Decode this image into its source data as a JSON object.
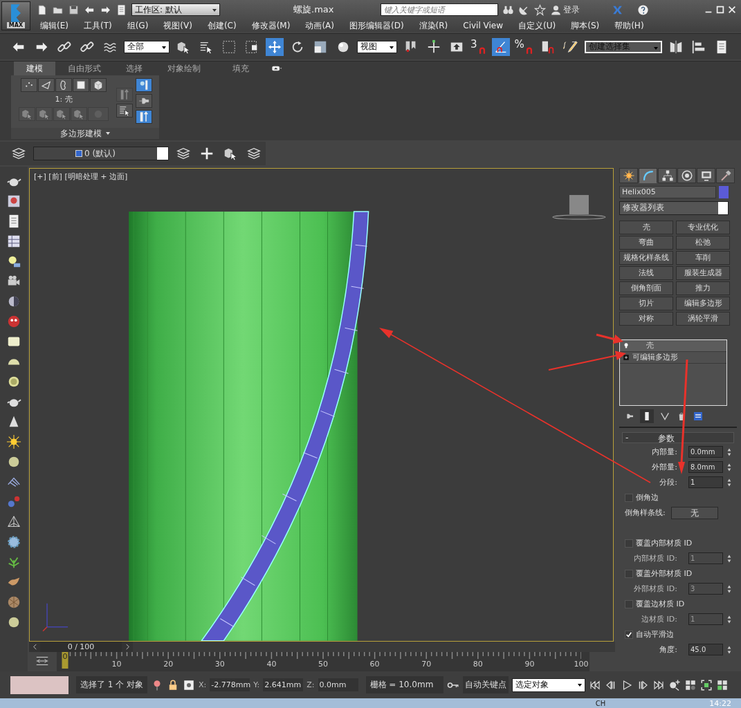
{
  "title_bar": {
    "app_menu_label": "MAX",
    "workspace": "工作区: 默认",
    "file_title": "螺旋.max",
    "search": {
      "placeholder": "键入关键字或短语"
    },
    "sign_in": "登录"
  },
  "menu_bar": [
    "编辑(E)",
    "工具(T)",
    "组(G)",
    "视图(V)",
    "创建(C)",
    "修改器(M)",
    "动画(A)",
    "图形编辑器(D)",
    "渲染(R)",
    "Civil View",
    "自定义(U)",
    "脚本(S)",
    "帮助(H)"
  ],
  "main_toolbar": {
    "selection_filter": "全部",
    "reference_coord": "视图",
    "move_active": true,
    "angle_snap_active": true,
    "snap_label": "3",
    "percent_label": "%",
    "selection_set": "创建选择集"
  },
  "ribbon": {
    "tabs": [
      {
        "label": "建模",
        "selected": true
      },
      {
        "label": "自由形式",
        "selected": false
      },
      {
        "label": "选择",
        "selected": false
      },
      {
        "label": "对象绘制",
        "selected": false
      },
      {
        "label": "填充",
        "selected": false
      }
    ],
    "panel_label": "1: 壳",
    "panel_title": "多边形建模"
  },
  "layer_toolbar": {
    "layer": "0 (默认)"
  },
  "viewport": {
    "label": "[+] [前] [明暗处理 + 边面]"
  },
  "command_panel": {
    "tabs": [
      {
        "kind": "create",
        "selected": false
      },
      {
        "kind": "modify",
        "selected": true
      },
      {
        "kind": "hierarchy",
        "selected": false
      },
      {
        "kind": "motion",
        "selected": false
      },
      {
        "kind": "display",
        "selected": false
      },
      {
        "kind": "utilities",
        "selected": false
      }
    ],
    "object_name": "Helix005",
    "modifier_list": "修改器列表",
    "modifier_buttons": [
      "壳",
      "专业优化",
      "弯曲",
      "松弛",
      "规格化样条线",
      "车削",
      "法线",
      "服装生成器",
      "倒角剖面",
      "推力",
      "切片",
      "编辑多边形",
      "对称",
      "涡轮平滑"
    ],
    "stack": [
      {
        "kind": "modifier",
        "label": "壳",
        "selected": true
      },
      {
        "kind": "base",
        "label": "可编辑多边形",
        "selected": false
      }
    ],
    "parameters": {
      "collapse_label": "-",
      "title": "参数",
      "rows": [
        {
          "kind": "spinner",
          "label": "内部量:",
          "value": "0.0mm",
          "disabled": false
        },
        {
          "kind": "spinner",
          "label": "外部量:",
          "value": "8.0mm",
          "disabled": false
        },
        {
          "kind": "spinner",
          "label": "分段:",
          "value": "1",
          "disabled": false
        },
        {
          "kind": "checkbox",
          "label": "倒角边",
          "checked": false
        },
        {
          "kind": "button",
          "label": "倒角样条线:",
          "value": "无"
        },
        {
          "kind": "checkbox",
          "label": "覆盖内部材质 ID",
          "checked": false
        },
        {
          "kind": "spinner",
          "label": "内部材质 ID:",
          "value": "1",
          "disabled": true
        },
        {
          "kind": "checkbox",
          "label": "覆盖外部材质 ID",
          "checked": false
        },
        {
          "kind": "spinner",
          "label": "外部材质 ID:",
          "value": "3",
          "disabled": true
        },
        {
          "kind": "checkbox",
          "label": "覆盖边材质 ID",
          "checked": false
        },
        {
          "kind": "spinner",
          "label": "边材质 ID:",
          "value": "1",
          "disabled": true
        },
        {
          "kind": "checkbox",
          "label": "自动平滑边",
          "checked": true
        },
        {
          "kind": "spinner",
          "label": "角度:",
          "value": "45.0",
          "disabled": false
        }
      ]
    }
  },
  "timeline": {
    "slider": {
      "label": "0 / 100",
      "level": 0
    },
    "ruler_labels": [
      "0",
      "10",
      "20",
      "30",
      "40",
      "50",
      "60",
      "70",
      "80",
      "90",
      "100"
    ]
  },
  "status_bar": {
    "selection": "选择了 1 个 对象",
    "x_label": "X:",
    "x": "-2.778mm",
    "y_label": "Y:",
    "y": "2.641mm",
    "z_label": "Z:",
    "z": "0.0mm",
    "grid": "栅格 = 10.0mm",
    "auto_key": "自动关键点",
    "key_filter": "选定对象"
  },
  "taskbar": {
    "language": "CH",
    "time": "14:22"
  }
}
